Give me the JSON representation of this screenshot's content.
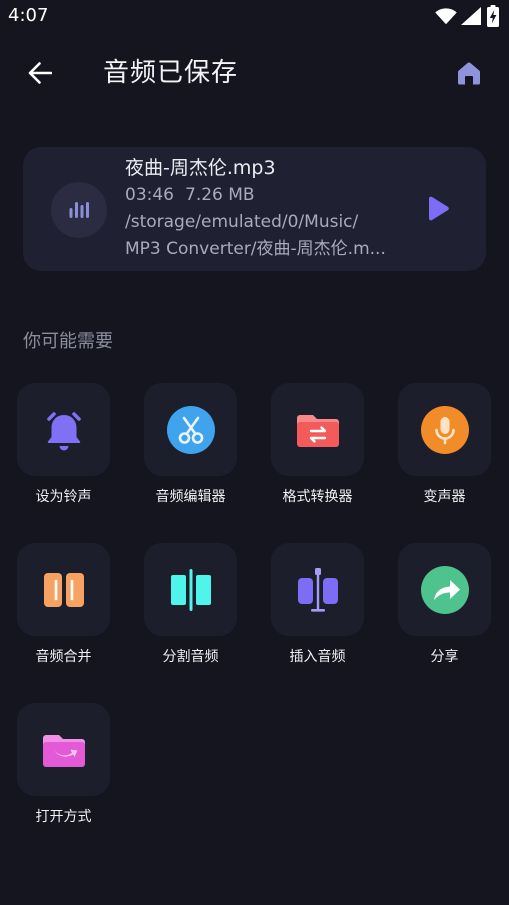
{
  "status_bar": {
    "time": "4:07",
    "icons": [
      "wifi-icon",
      "signal-icon",
      "battery-charging-icon"
    ]
  },
  "header": {
    "title": "音频已保存",
    "back_icon": "arrow-left-icon",
    "home_icon": "home-icon"
  },
  "file_card": {
    "name": "夜曲-周杰伦.mp3",
    "duration": "03:46",
    "size": "7.26 MB",
    "path_lines": [
      "/storage/emulated/0/Music/",
      "MP3 Converter/夜曲-周杰伦.m..."
    ],
    "thumb_icon": "audio-bars-icon",
    "play_icon": "play-icon"
  },
  "suggestions": {
    "title": "你可能需要",
    "tools": [
      {
        "label": "设为铃声",
        "icon": "bell-icon",
        "color": "#8070f6"
      },
      {
        "label": "音频编辑器",
        "icon": "scissors-icon",
        "color": "#3fa3ee"
      },
      {
        "label": "格式转换器",
        "icon": "folder-convert-icon",
        "color": "#f25a5c"
      },
      {
        "label": "变声器",
        "icon": "microphone-icon",
        "color": "#f28c28"
      },
      {
        "label": "音频合并",
        "icon": "merge-icon",
        "color": "#f7a262"
      },
      {
        "label": "分割音频",
        "icon": "split-icon",
        "color": "#4ff4ea"
      },
      {
        "label": "插入音频",
        "icon": "insert-icon",
        "color": "#7c6cf6"
      },
      {
        "label": "分享",
        "icon": "share-icon",
        "color": "#4fc38e"
      },
      {
        "label": "打开方式",
        "icon": "folder-open-with-icon",
        "color": "#e25ad6"
      }
    ]
  },
  "colors": {
    "background": "#14151e",
    "card": "#1f2031",
    "tile": "#1d1e2c",
    "accent": "#7c6cf6",
    "home_icon": "#8e93dc",
    "secondary_text": "#a9abbb"
  }
}
